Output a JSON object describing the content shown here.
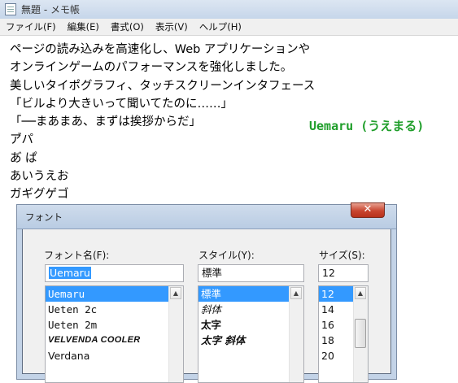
{
  "window": {
    "title": "無題 - メモ帳"
  },
  "menu": [
    "ファイル(F)",
    "編集(E)",
    "書式(O)",
    "表示(V)",
    "ヘルプ(H)"
  ],
  "editor_lines": [
    "ページの読み込みを高速化し、Web アプリケーションや",
    "オンラインゲームのパフォーマンスを強化しました。",
    "美しいタイポグラフィ、タッチスクリーンインタフェース",
    "「ビルより大きいって聞いてたのに……」",
    "「──まあまあ、まずは挨拶からだ」",
    "ア゙パ",
    "あ゙ ぱ",
    "あいうえお",
    "ガギグゲゴ"
  ],
  "annotation": "Uemaru (うえまる)",
  "dialog": {
    "title": "フォント",
    "close_glyph": "✕",
    "font_name_label": "フォント名(F):",
    "style_label": "スタイル(Y):",
    "size_label": "サイズ(S):",
    "font_name_value": "Uemaru",
    "style_value": "標準",
    "size_value": "12",
    "font_list": [
      "Uemaru",
      "Ueten 2c",
      "Ueten 2m",
      "VELVENDA COOLER",
      "Verdana"
    ],
    "style_list": [
      "標準",
      "斜体",
      "太字",
      "太字 斜体"
    ],
    "size_list": [
      "12",
      "14",
      "16",
      "18",
      "20"
    ]
  },
  "colors": {
    "annotation": "#1f9e2a",
    "selection": "#3399ff"
  }
}
